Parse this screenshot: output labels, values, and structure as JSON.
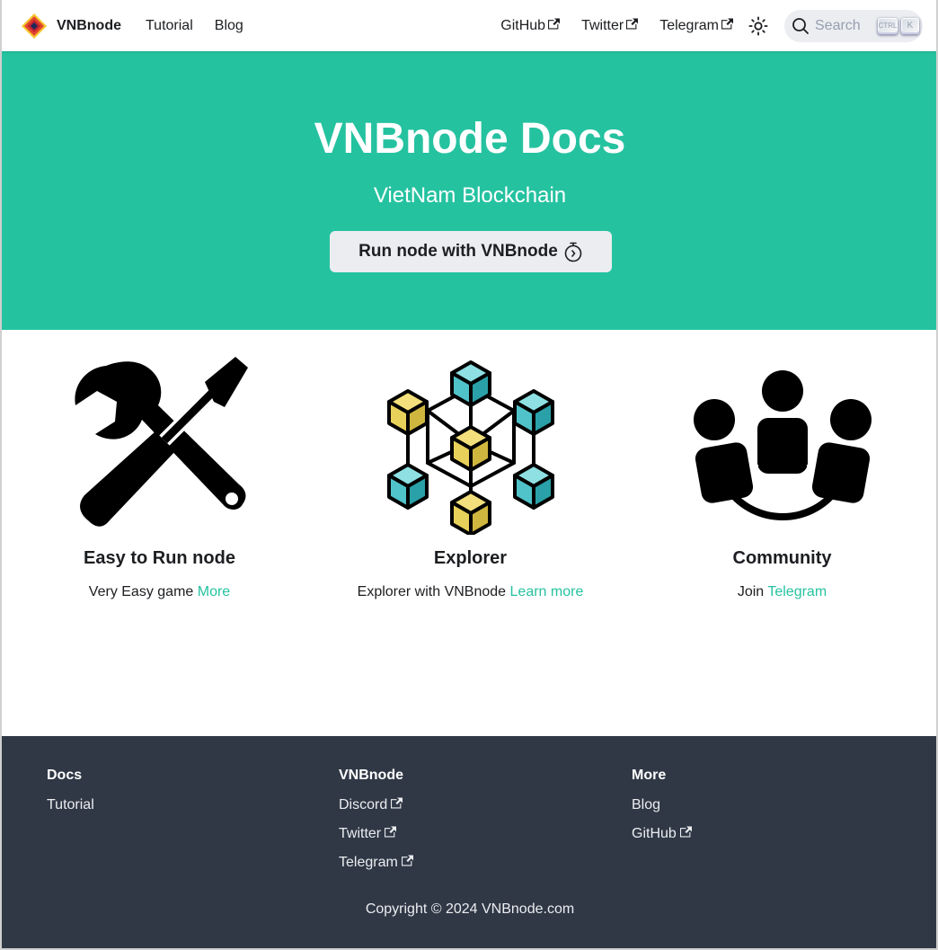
{
  "navbar": {
    "brand": "VNBnode",
    "links_left": [
      "Tutorial",
      "Blog"
    ],
    "links_right": [
      "GitHub",
      "Twitter",
      "Telegram"
    ],
    "search_placeholder": "Search",
    "search_keys": [
      "CTRL",
      "K"
    ],
    "theme_icon": "sun-icon"
  },
  "hero": {
    "title": "VNBnode Docs",
    "subtitle": "VietNam Blockchain",
    "button_label": "Run node with VNBnode",
    "button_icon": "stopwatch-icon"
  },
  "features": [
    {
      "title": "Easy to Run node",
      "text": "Very Easy game",
      "link": "More",
      "icon": "tools-icon"
    },
    {
      "title": "Explorer",
      "text": "Explorer with VNBnode",
      "link": "Learn more",
      "icon": "blockchain-cubes-icon"
    },
    {
      "title": "Community",
      "text": "Join",
      "link": "Telegram",
      "icon": "community-icon"
    }
  ],
  "footer": {
    "columns": [
      {
        "title": "Docs",
        "links": [
          "Tutorial"
        ]
      },
      {
        "title": "VNBnode",
        "links": [
          "Discord",
          "Twitter",
          "Telegram"
        ]
      },
      {
        "title": "More",
        "links": [
          "Blog",
          "GitHub"
        ]
      }
    ],
    "copyright": "Copyright © 2024 VNBnode.com"
  },
  "colors": {
    "primary": "#25c2a0",
    "footer_bg": "#303846",
    "cube_teal": "#4fc3c9",
    "cube_yellow": "#e8d15a"
  }
}
